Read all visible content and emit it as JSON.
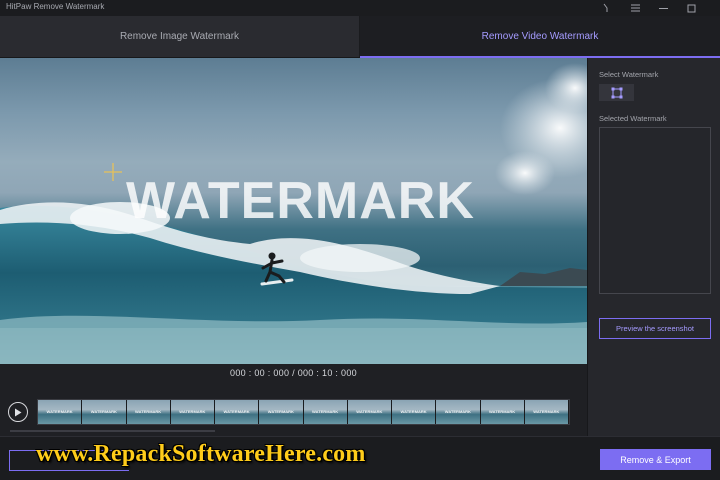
{
  "window": {
    "title": "HitPaw Remove Watermark",
    "controls": [
      "pin-icon",
      "menu-icon",
      "minimize-icon",
      "maximize-icon"
    ]
  },
  "tabs": [
    {
      "label": "Remove Image Watermark",
      "active": false
    },
    {
      "label": "Remove Video Watermark",
      "active": true
    }
  ],
  "preview": {
    "watermark_text": "WATERMARK",
    "timecode": "000 : 00 : 000 / 000 : 10 : 000"
  },
  "timeline": {
    "play_icon": "play-icon",
    "thumbnail_label": "WATERMARK",
    "thumbnail_count": 12
  },
  "sidebar": {
    "select_label": "Select Watermark",
    "select_icon": "selection-frame-icon",
    "selected_label": "Selected Watermark",
    "preview_button": "Preview the screenshot"
  },
  "bottombar": {
    "export_button": "Remove & Export"
  },
  "overlay": {
    "site_text": "www.RepackSoftwareHere.com"
  },
  "colors": {
    "accent": "#7c6df2",
    "accent_text": "#a59bff",
    "background": "#1f2024",
    "panel": "#26272c",
    "overlay_text": "#ffcc1a"
  }
}
